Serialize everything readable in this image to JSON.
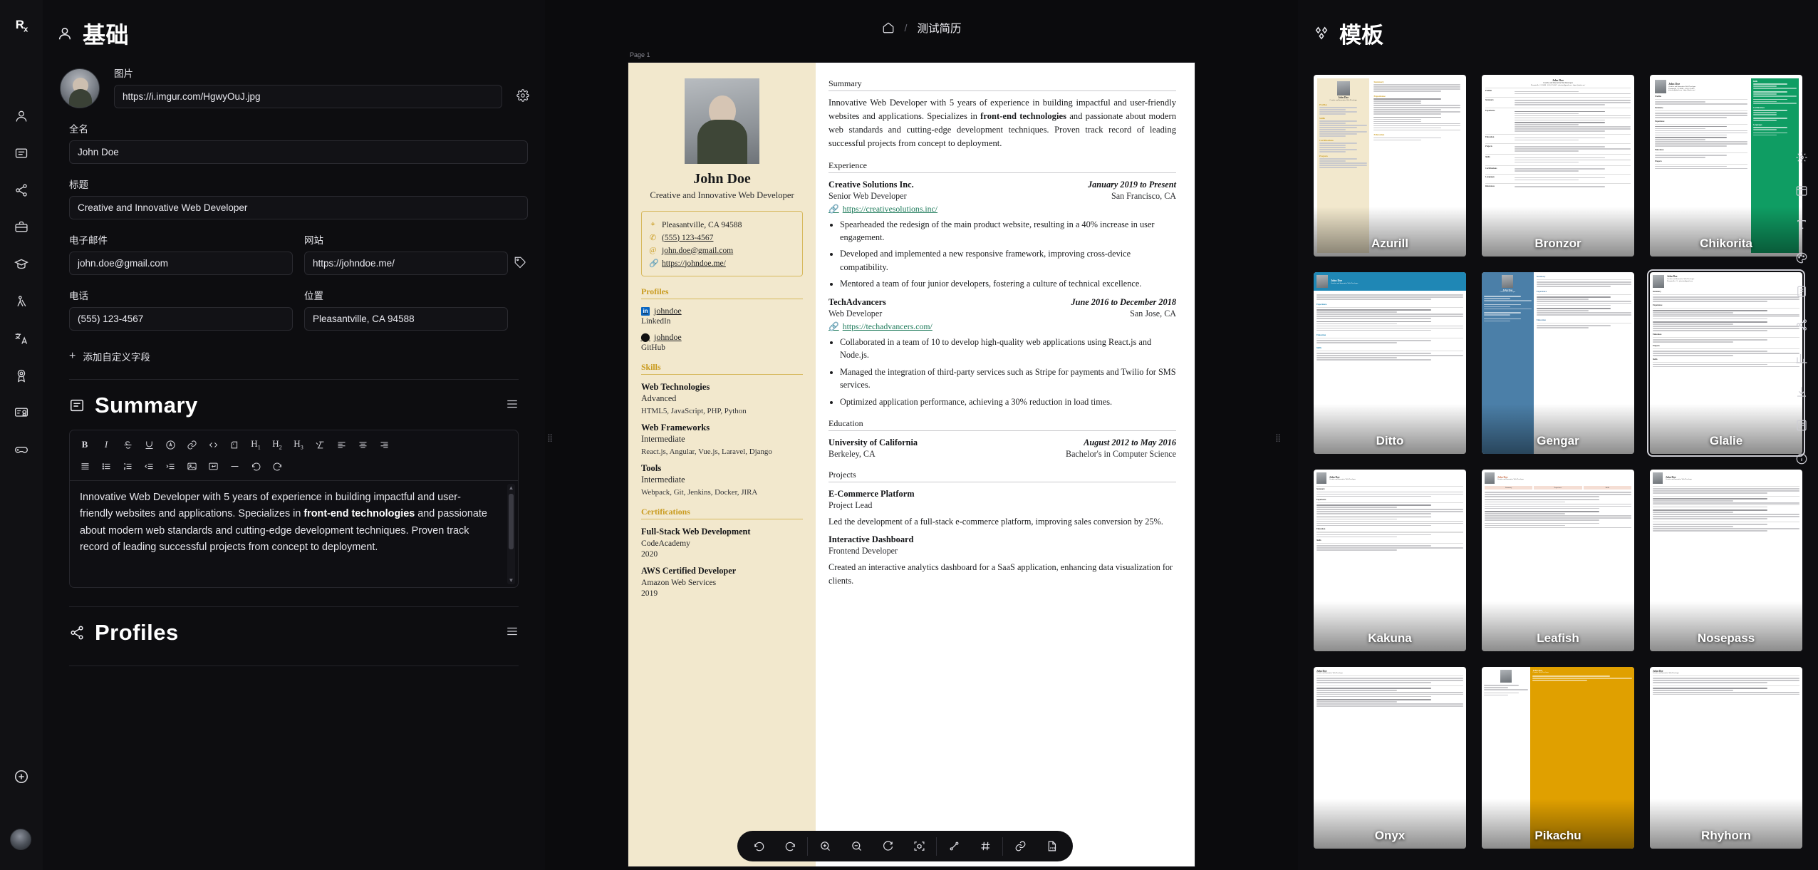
{
  "rail": {
    "logo": "Rx",
    "items": [
      {
        "name": "basics",
        "icon": "user-icon"
      },
      {
        "name": "summary",
        "icon": "note-icon"
      },
      {
        "name": "profiles",
        "icon": "share-icon"
      },
      {
        "name": "experience",
        "icon": "briefcase-icon"
      },
      {
        "name": "education",
        "icon": "graduation-cap-icon"
      },
      {
        "name": "skills",
        "icon": "compass-icon"
      },
      {
        "name": "languages",
        "icon": "translate-icon"
      },
      {
        "name": "awards",
        "icon": "medal-icon"
      },
      {
        "name": "certifications",
        "icon": "certificate-icon"
      },
      {
        "name": "interests",
        "icon": "gamepad-icon"
      }
    ],
    "add_label": "add-icon",
    "avatar": "user-avatar"
  },
  "editor": {
    "section_title": "基础",
    "section_icon": "user-icon",
    "picture": {
      "label": "图片",
      "value": "https://i.imgur.com/HgwyOuJ.jpg",
      "settings_icon": "gear-icon"
    },
    "fields": [
      {
        "label": "全名",
        "value": "John Doe",
        "name": "full-name"
      },
      {
        "label": "标题",
        "value": "Creative and Innovative Web Developer",
        "name": "headline"
      },
      {
        "label": "电子邮件",
        "value": "john.doe@gmail.com",
        "name": "email"
      },
      {
        "label": "网站",
        "value": "https://johndoe.me/",
        "name": "website"
      },
      {
        "label": "电话",
        "value": "(555) 123-4567",
        "name": "phone"
      },
      {
        "label": "位置",
        "value": "Pleasantville, CA 94588",
        "name": "location"
      }
    ],
    "add_custom_field": "添加自定义字段",
    "summary": {
      "title": "Summary",
      "icon": "note-icon",
      "toolbar_row1": [
        "B",
        "I",
        "S",
        "A",
        "@",
        "link",
        "code",
        "quote",
        "H1",
        "H2",
        "H3",
        "clear",
        "align-left",
        "align-center",
        "align-right"
      ],
      "toolbar_row2": [
        "align-justify",
        "bullet-list",
        "numbered-list",
        "outdent",
        "indent",
        "image",
        "line-break",
        "divider",
        "undo",
        "redo"
      ],
      "body_pre": "Innovative Web Developer with 5 years of experience in building impactful and user-friendly websites and applications. Specializes in ",
      "body_bold": "front-end technologies",
      "body_post": " and passionate about modern web standards and cutting-edge development techniques. Proven track record of leading successful projects from concept to deployment."
    },
    "profiles": {
      "title": "Profiles",
      "icon": "share-icon"
    }
  },
  "center": {
    "home_icon": "home-icon",
    "separator": "/",
    "title": "测试简历",
    "page_label": "Page 1",
    "toolbar": [
      {
        "name": "undo",
        "icon": "undo-icon"
      },
      {
        "name": "redo",
        "icon": "redo-icon"
      },
      {
        "name": "zoom-in",
        "icon": "zoom-in-icon"
      },
      {
        "name": "zoom-out",
        "icon": "zoom-out-icon"
      },
      {
        "name": "reset-zoom",
        "icon": "reset-clock-icon"
      },
      {
        "name": "center-artboard",
        "icon": "focus-icon"
      },
      {
        "name": "toggle-page-break",
        "icon": "ruler-icon"
      },
      {
        "name": "toggle-grid",
        "icon": "hash-icon"
      },
      {
        "name": "copy-link",
        "icon": "link-icon"
      },
      {
        "name": "download-pdf",
        "icon": "pdf-icon"
      }
    ]
  },
  "resume": {
    "name": "John Doe",
    "headline": "Creative and Innovative Web Developer",
    "contact": [
      {
        "icon": "map-pin-icon",
        "text": "Pleasantville, CA 94588",
        "link": false
      },
      {
        "icon": "phone-icon",
        "text": "(555) 123-4567",
        "link": true
      },
      {
        "icon": "at-icon",
        "text": "john.doe@gmail.com",
        "link": true
      },
      {
        "icon": "link-icon",
        "text": "https://johndoe.me/",
        "link": true
      }
    ],
    "profiles_title": "Profiles",
    "profiles": [
      {
        "handle": "johndoe",
        "network": "LinkedIn",
        "badge": "in"
      },
      {
        "handle": "johndoe",
        "network": "GitHub",
        "badge": "gh"
      }
    ],
    "skills_title": "Skills",
    "skills": [
      {
        "name": "Web Technologies",
        "level": "Advanced",
        "keywords": "HTML5, JavaScript, PHP, Python"
      },
      {
        "name": "Web Frameworks",
        "level": "Intermediate",
        "keywords": "React.js, Angular, Vue.js, Laravel, Django"
      },
      {
        "name": "Tools",
        "level": "Intermediate",
        "keywords": "Webpack, Git, Jenkins, Docker, JIRA"
      }
    ],
    "certifications_title": "Certifications",
    "certifications": [
      {
        "name": "Full-Stack Web Development",
        "issuer": "CodeAcademy",
        "date": "2020"
      },
      {
        "name": "AWS Certified Developer",
        "issuer": "Amazon Web Services",
        "date": "2019"
      }
    ],
    "summary_title": "Summary",
    "summary_pre": "Innovative Web Developer with 5 years of experience in building impactful and user-friendly websites and applications. Specializes in ",
    "summary_bold": "front-end technologies",
    "summary_post": " and passionate about modern web standards and cutting-edge development techniques. Proven track record of leading successful projects from concept to deployment.",
    "experience_title": "Experience",
    "experience": [
      {
        "company": "Creative Solutions Inc.",
        "date": "January 2019 to Present",
        "role": "Senior Web Developer",
        "location": "San Francisco, CA",
        "url": "https://creativesolutions.inc/",
        "bullets": [
          "Spearheaded the redesign of the main product website, resulting in a 40% increase in user engagement.",
          "Developed and implemented a new responsive framework, improving cross-device compatibility.",
          "Mentored a team of four junior developers, fostering a culture of technical excellence."
        ]
      },
      {
        "company": "TechAdvancers",
        "date": "June 2016 to December 2018",
        "role": "Web Developer",
        "location": "San Jose, CA",
        "url": "https://techadvancers.com/",
        "bullets": [
          "Collaborated in a team of 10 to develop high-quality web applications using React.js and Node.js.",
          "Managed the integration of third-party services such as Stripe for payments and Twilio for SMS services.",
          "Optimized application performance, achieving a 30% reduction in load times."
        ]
      }
    ],
    "education_title": "Education",
    "education": [
      {
        "school": "University of California",
        "date": "August 2012 to May 2016",
        "location": "Berkeley, CA",
        "degree": "Bachelor's in Computer Science"
      }
    ],
    "projects_title": "Projects",
    "projects": [
      {
        "name": "E-Commerce Platform",
        "role": "Project Lead",
        "desc": "Led the development of a full-stack e-commerce platform, improving sales conversion by 25%."
      },
      {
        "name": "Interactive Dashboard",
        "role": "Frontend Developer",
        "desc": "Created an interactive analytics dashboard for a SaaS application, enhancing data visualization for clients."
      }
    ]
  },
  "templates": {
    "title": "模板",
    "icon": "templates-icon",
    "items": [
      {
        "name": "Azurill",
        "selected": false,
        "accent": "#c99b1f",
        "style": "sidebar-cream"
      },
      {
        "name": "Bronzor",
        "selected": false,
        "accent": "#555555",
        "style": "table"
      },
      {
        "name": "Chikorita",
        "selected": false,
        "accent": "#0f9d63",
        "style": "right-green"
      },
      {
        "name": "Ditto",
        "selected": false,
        "accent": "#1f87b5",
        "style": "top-blue"
      },
      {
        "name": "Gengar",
        "selected": false,
        "accent": "#4b7fa8",
        "style": "left-blue"
      },
      {
        "name": "Glalie",
        "selected": true,
        "accent": "#9ec8d8",
        "style": "plain"
      },
      {
        "name": "Kakuna",
        "selected": false,
        "accent": "#8b8b8b",
        "style": "plain"
      },
      {
        "name": "Leafish",
        "selected": false,
        "accent": "#c96f4a",
        "style": "tabs"
      },
      {
        "name": "Nosepass",
        "selected": false,
        "accent": "#6aa84f",
        "style": "plain"
      },
      {
        "name": "Onyx",
        "selected": false,
        "accent": "#333333",
        "style": "plain"
      },
      {
        "name": "Pikachu",
        "selected": false,
        "accent": "#e0a000",
        "style": "yellow"
      },
      {
        "name": "Rhyhorn",
        "selected": false,
        "accent": "#888888",
        "style": "plain"
      }
    ],
    "side_icons": [
      {
        "name": "settings",
        "icon": "gear-icon"
      },
      {
        "name": "layout",
        "icon": "layout-icon"
      },
      {
        "name": "typography",
        "icon": "typography-icon"
      },
      {
        "name": "theme",
        "icon": "palette-icon"
      },
      {
        "name": "page",
        "icon": "page-icon"
      },
      {
        "name": "sharing",
        "icon": "share-nodes-icon"
      },
      {
        "name": "statistics",
        "icon": "chart-icon"
      },
      {
        "name": "export",
        "icon": "download-icon"
      },
      {
        "name": "notes",
        "icon": "notes-icon"
      },
      {
        "name": "information",
        "icon": "info-icon"
      }
    ]
  }
}
